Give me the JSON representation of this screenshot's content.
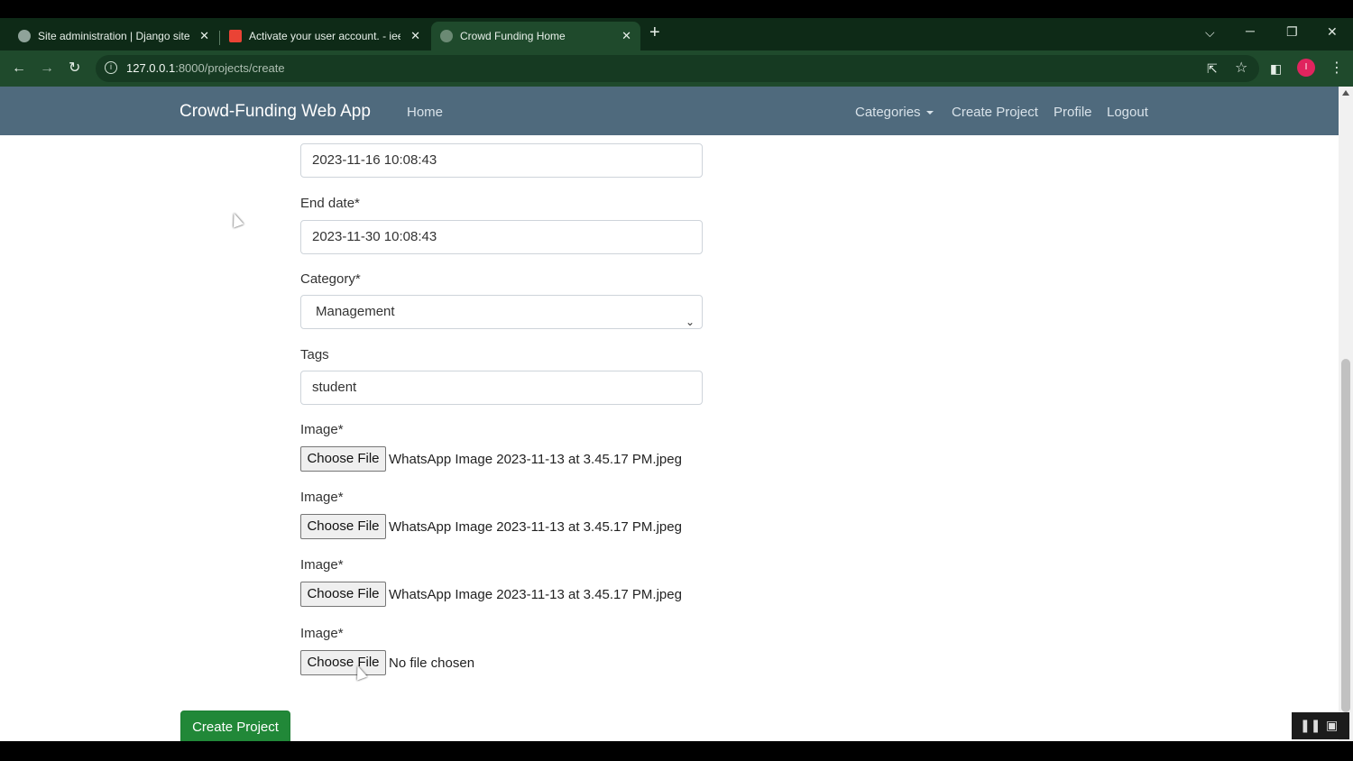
{
  "browser": {
    "tabs": [
      {
        "title": "Site administration | Django site",
        "close": "✕",
        "favicon_color": "#8fa39a"
      },
      {
        "title": "Activate your user account. - iee",
        "close": "✕",
        "favicon_color": "#ea4335"
      },
      {
        "title": "Crowd Funding Home",
        "close": "✕",
        "favicon_color": "#6b8a74",
        "active": true
      }
    ],
    "new_tab": "+",
    "url_host": "127.0.0.1",
    "url_path": ":8000/projects/create",
    "avatar_letter": "I",
    "window_controls": [
      "⌵",
      "─",
      "❐",
      "✕"
    ]
  },
  "navbar": {
    "brand": "Crowd-Funding Web App",
    "home": "Home",
    "categories": "Categories",
    "create_project": "Create Project",
    "profile": "Profile",
    "logout": "Logout"
  },
  "form": {
    "start_date_value": "2023-11-16 10:08:43",
    "end_date_label": "End date*",
    "end_date_value": "2023-11-30 10:08:43",
    "category_label": "Category*",
    "category_value": "Management",
    "tags_label": "Tags",
    "tags_value": "student",
    "images": [
      {
        "label": "Image*",
        "button": "Choose File",
        "file": "WhatsApp Image 2023-11-13 at 3.45.17 PM.jpeg"
      },
      {
        "label": "Image*",
        "button": "Choose File",
        "file": "WhatsApp Image 2023-11-13 at 3.45.17 PM.jpeg"
      },
      {
        "label": "Image*",
        "button": "Choose File",
        "file": "WhatsApp Image 2023-11-13 at 3.45.17 PM.jpeg"
      },
      {
        "label": "Image*",
        "button": "Choose File",
        "file": "No file chosen"
      }
    ],
    "submit": "Create Project"
  },
  "colors": {
    "navbar": "#4f6a7d",
    "submit": "#218838",
    "chrome": "#1f4a2c"
  }
}
